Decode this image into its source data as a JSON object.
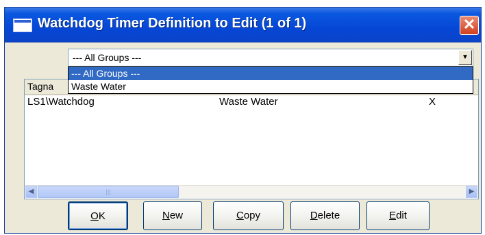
{
  "window": {
    "title": "Watchdog Timer Definition to Edit (1 of 1)",
    "close_glyph": "✕"
  },
  "group_combo": {
    "value": "--- All Groups ---",
    "arrow_glyph": "▼",
    "options": [
      {
        "label": "--- All Groups ---",
        "selected": true
      },
      {
        "label": "Waste Water",
        "selected": false
      }
    ]
  },
  "list": {
    "columns": [
      "Tagname",
      "",
      ""
    ],
    "header_visible": "Tagna",
    "rows": [
      {
        "tagname": "LS1\\Watchdog",
        "group": "Waste Water",
        "flag": "X"
      }
    ]
  },
  "scrollbar": {
    "left_glyph": "◀",
    "right_glyph": "▶",
    "thumb_grip": "|||"
  },
  "buttons": {
    "ok": {
      "mnemonic": "O",
      "rest": "K"
    },
    "new": {
      "mnemonic": "N",
      "rest": "ew"
    },
    "copy": {
      "mnemonic": "C",
      "rest": "opy"
    },
    "delete": {
      "mnemonic": "D",
      "rest": "elete"
    },
    "edit": {
      "mnemonic": "E",
      "rest": "dit"
    }
  },
  "colors": {
    "titlebar": "#0647d6",
    "selection": "#316ac5",
    "window_bg": "#ece9d8"
  }
}
